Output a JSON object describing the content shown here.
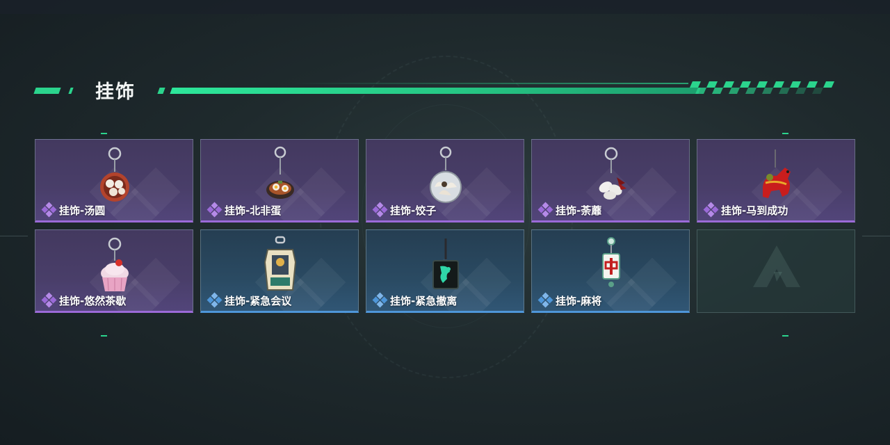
{
  "section": {
    "title": "挂饰"
  },
  "colors": {
    "accent": "#2bd48d",
    "rarity_purple": "#9b6ad8",
    "rarity_blue": "#4e96d9"
  },
  "items": [
    {
      "label": "挂饰-汤圆",
      "rarity": "purple",
      "icon": "tangyuan-charm-icon"
    },
    {
      "label": "挂饰-北非蛋",
      "rarity": "purple",
      "icon": "shakshuka-charm-icon"
    },
    {
      "label": "挂饰-饺子",
      "rarity": "purple",
      "icon": "dumpling-charm-icon"
    },
    {
      "label": "挂饰-荼蘼",
      "rarity": "purple",
      "icon": "flower-charm-icon"
    },
    {
      "label": "挂饰-马到成功",
      "rarity": "purple",
      "icon": "red-horse-charm-icon"
    },
    {
      "label": "挂饰-悠然茶歇",
      "rarity": "purple",
      "icon": "cupcake-charm-icon"
    },
    {
      "label": "挂饰-紧急会议",
      "rarity": "blue",
      "icon": "meeting-sign-charm-icon"
    },
    {
      "label": "挂饰-紧急撤离",
      "rarity": "blue",
      "icon": "evacuation-badge-charm-icon"
    },
    {
      "label": "挂饰-麻将",
      "rarity": "blue",
      "icon": "mahjong-tile-charm-icon"
    },
    {
      "label": "",
      "rarity": "empty",
      "icon": "empty-slot-logo-icon"
    }
  ]
}
